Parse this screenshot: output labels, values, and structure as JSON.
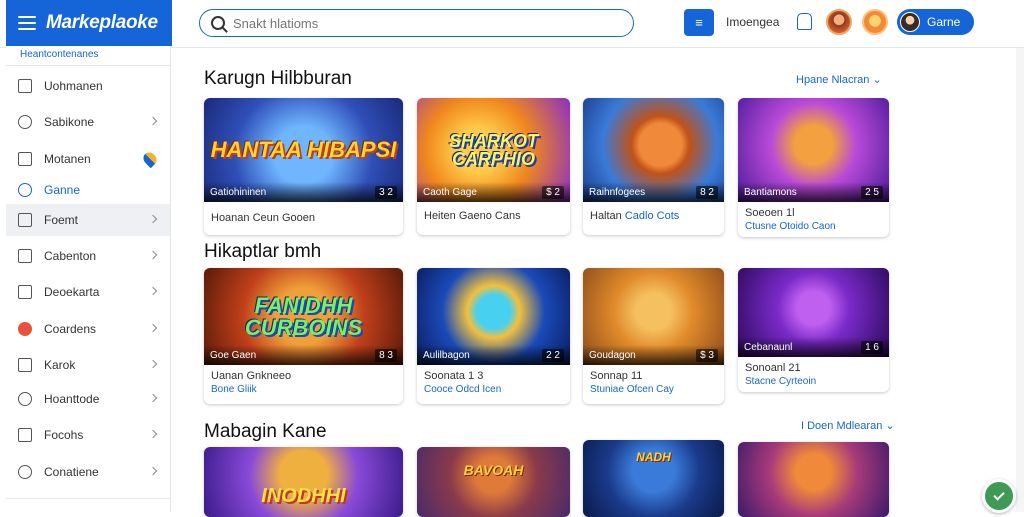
{
  "header": {
    "brand": "Markeplaoke",
    "search_placeholder": "Snakt hlatioms",
    "grid_label": "≡",
    "language": "Imoengea",
    "user_label": "Garne"
  },
  "sidebar": {
    "top": "Heantcontenanes",
    "items": [
      {
        "label": "Uohmanen"
      },
      {
        "label": "Sabikone"
      },
      {
        "label": "Motanen"
      },
      {
        "label": "Ganne"
      },
      {
        "label": "Foemt"
      },
      {
        "label": "Cabenton"
      },
      {
        "label": "Deoekarta"
      },
      {
        "label": "Coardens"
      },
      {
        "label": "Karok"
      },
      {
        "label": "Hoanttode"
      },
      {
        "label": "Focohs"
      },
      {
        "label": "Conatiene"
      }
    ]
  },
  "sections": [
    {
      "title": "Karugn Hilbburan",
      "more": "Hpane Nlacran",
      "cards": [
        {
          "art": "HANTAA HIBAPSI",
          "badge": "Gatiohininen",
          "num": "3 2",
          "l1": "Hoanan Ceun Gooen",
          "l2": ""
        },
        {
          "art": "SHARKOT CARPHIO",
          "badge": "Caoth Gage",
          "num": "$ 2",
          "l1": "Heiten Gaeno Cans",
          "l2": ""
        },
        {
          "art": "",
          "badge": "Raihnfogees",
          "num": "8 2",
          "l1": "Haltan",
          "l1b": "Cadlo Cots",
          "l2": ""
        },
        {
          "art": "",
          "badge": "Bantiamons",
          "num": "2 5",
          "l1": "Soeoen 1l",
          "l2": "Ctusne Otoido Caon"
        }
      ]
    },
    {
      "title": "Hikaptlar bmh",
      "more": "",
      "cards": [
        {
          "art": "FANIDHH CURBOINS",
          "badge": "Goe Gaen",
          "num": "8 3",
          "l1": "Uanan Gnkneeo",
          "l2": "Bone Gliik"
        },
        {
          "art": "",
          "badge": "Aulilbagon",
          "num": "2 2",
          "l1": "Soonata 1 3",
          "l2": "Cooce Odcd Icen"
        },
        {
          "art": "",
          "badge": "Goudagon",
          "num": "$ 3",
          "l1": "Sonnap 11",
          "l2": "Stuniae Ofcen Cay"
        },
        {
          "art": "",
          "badge": "Cebanaunl",
          "num": "1 6",
          "l1": "Sonoanl 21",
          "l2": "Stacne Cyrteoin"
        }
      ]
    },
    {
      "title": "Mabagin Kane",
      "more": "I Doen Mdlearan",
      "cards": [
        {
          "art": "INODHHI",
          "badge": "",
          "num": "",
          "l1": "",
          "l2": ""
        },
        {
          "art": "BAVOAH",
          "badge": "",
          "num": "",
          "l1": "",
          "l2": ""
        },
        {
          "art": "NADH",
          "badge": "",
          "num": "",
          "l1": "",
          "l2": ""
        },
        {
          "art": "",
          "badge": "",
          "num": "",
          "l1": "",
          "l2": ""
        }
      ]
    }
  ],
  "colors": {
    "accent": "#1565d8",
    "fab": "#3f9a56"
  },
  "icons": [
    "menu-icon",
    "search-icon",
    "bell-icon",
    "chevron-right-icon",
    "check-icon"
  ]
}
